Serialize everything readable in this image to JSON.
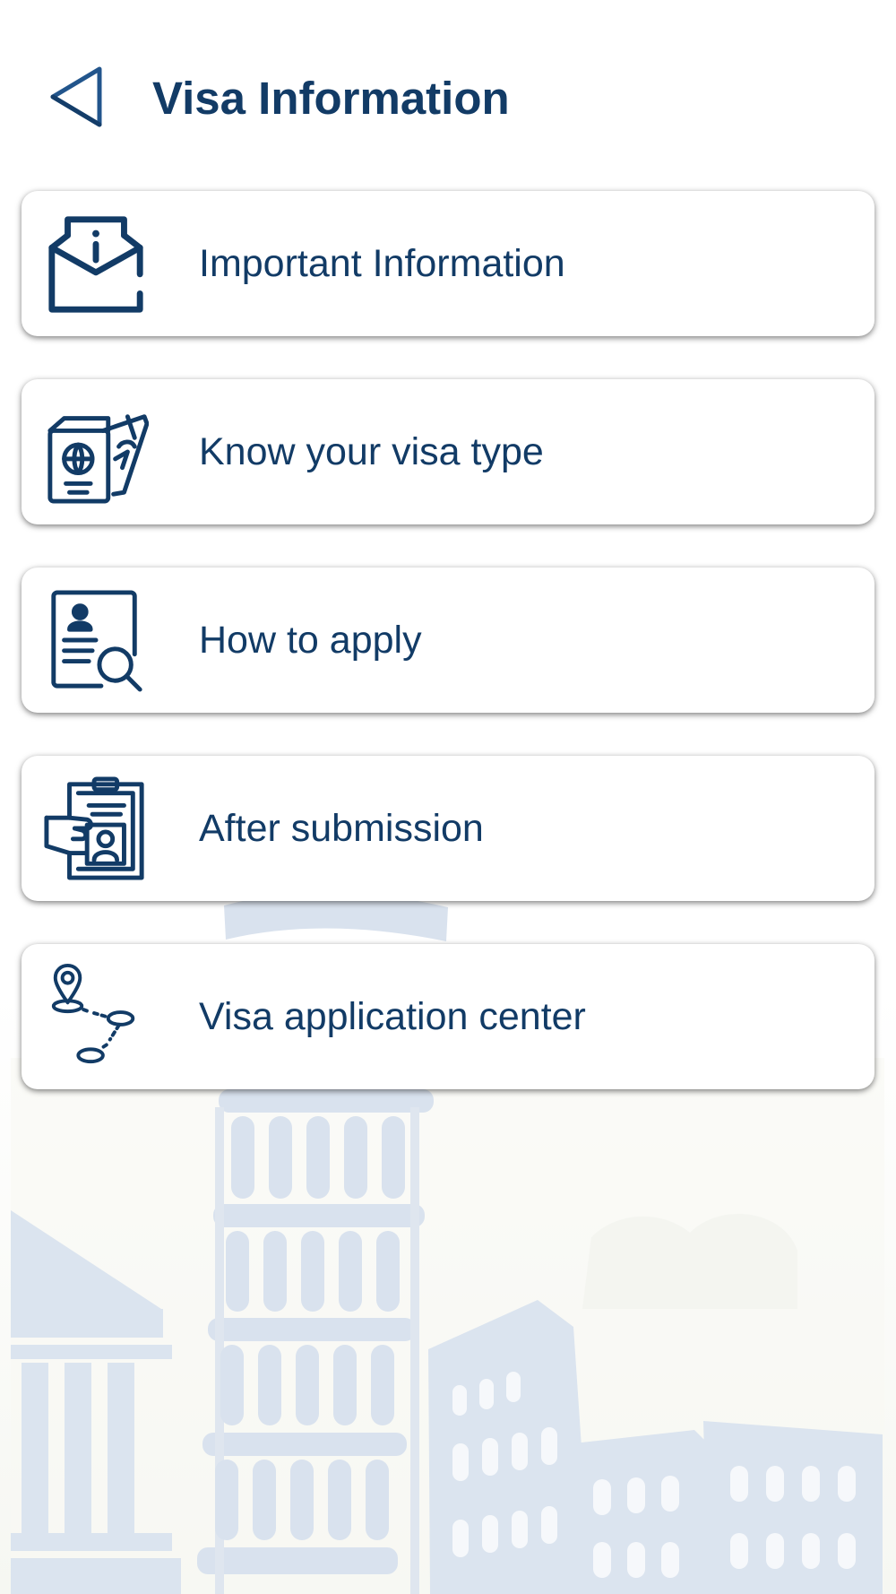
{
  "header": {
    "title": "Visa Information",
    "back_icon": "back-triangle-icon"
  },
  "menu": {
    "items": [
      {
        "label": "Important Information",
        "icon": "envelope-info-icon"
      },
      {
        "label": "Know your visa type",
        "icon": "passport-ticket-icon"
      },
      {
        "label": "How to apply",
        "icon": "document-search-icon"
      },
      {
        "label": "After submission",
        "icon": "clipboard-hand-icon"
      },
      {
        "label": "Visa application center",
        "icon": "location-route-icon"
      }
    ]
  },
  "colors": {
    "primary": "#123b66",
    "card_background": "#ffffff",
    "background_illustration": "#dbe4ef"
  }
}
